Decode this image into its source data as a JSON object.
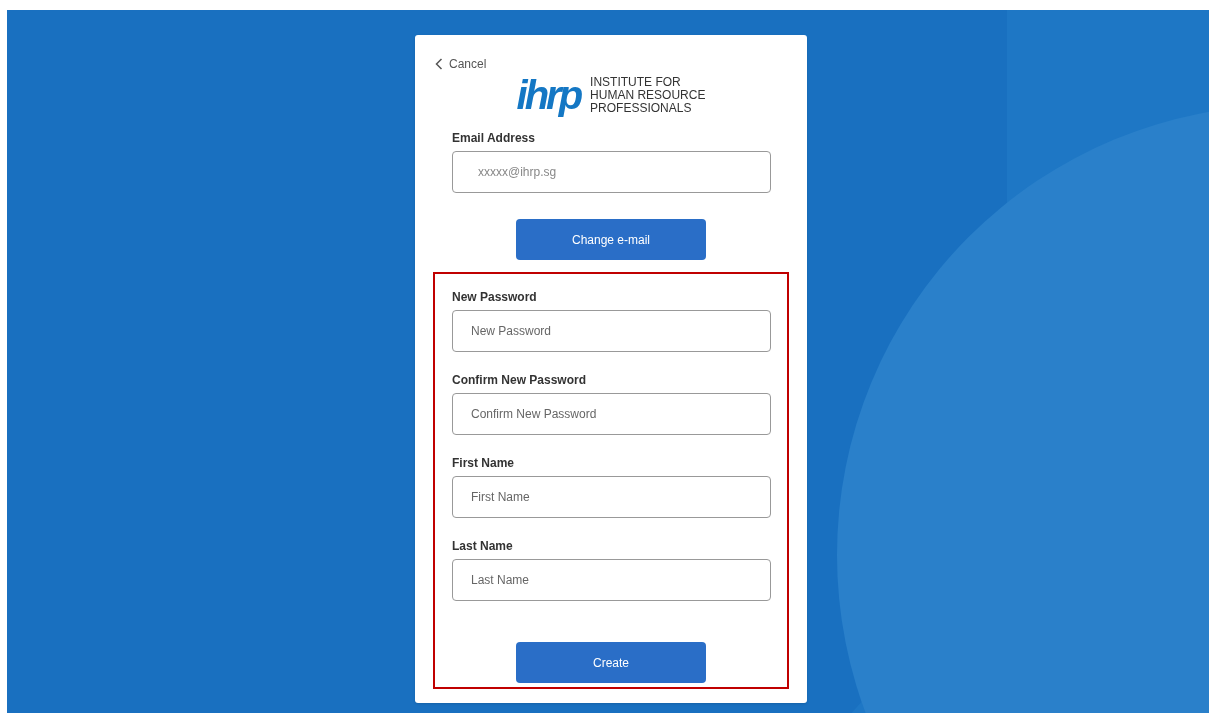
{
  "cancel_link": {
    "label": "Cancel"
  },
  "logo": {
    "mark": "ihrp",
    "name_lines": [
      "INSTITUTE FOR",
      "HUMAN RESOURCE",
      "PROFESSIONALS"
    ]
  },
  "email": {
    "label": "Email Address",
    "value": "xxxxx@ihrp.sg"
  },
  "change_email_button": {
    "label": "Change e-mail"
  },
  "highlighted_section": {
    "fields": [
      {
        "label": "New Password",
        "placeholder": "New Password"
      },
      {
        "label": "Confirm New Password",
        "placeholder": "Confirm New Password"
      },
      {
        "label": "First Name",
        "placeholder": "First Name"
      },
      {
        "label": "Last Name",
        "placeholder": "Last Name"
      }
    ],
    "create_button": {
      "label": "Create"
    }
  }
}
